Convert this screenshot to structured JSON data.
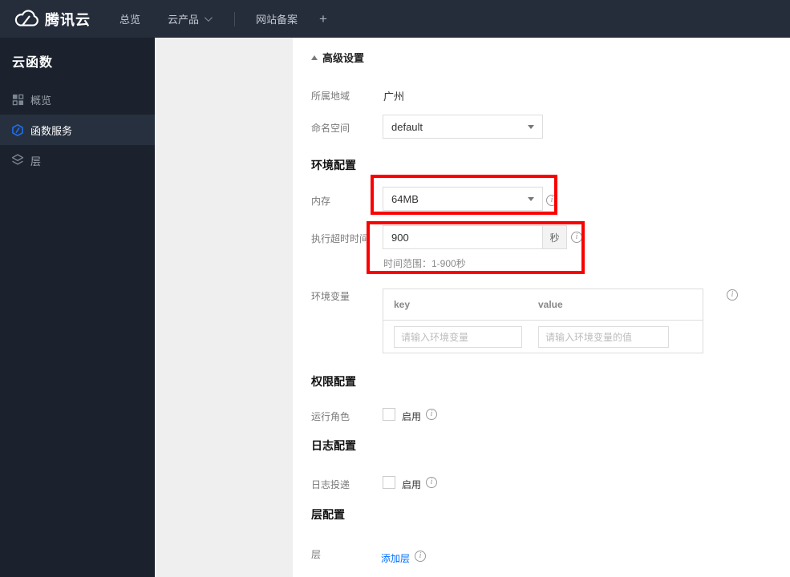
{
  "navbar": {
    "brand": "腾讯云",
    "overview": "总览",
    "products": "云产品",
    "icp": "网站备案",
    "add": "+"
  },
  "sidebar": {
    "title": "云函数",
    "items": [
      {
        "label": "概览",
        "icon": "grid-icon"
      },
      {
        "label": "函数服务",
        "icon": "scf-hexagon-icon"
      },
      {
        "label": "层",
        "icon": "layers-icon"
      }
    ]
  },
  "content": {
    "advanced_toggle": "高级设置",
    "region_label": "所属地域",
    "region_value": "广州",
    "namespace_label": "命名空间",
    "namespace_value": "default",
    "section_env": "环境配置",
    "memory_label": "内存",
    "memory_value": "64MB",
    "timeout_label": "执行超时时间",
    "timeout_value": "900",
    "timeout_unit": "秒",
    "timeout_hint": "时间范围：1-900秒",
    "envvar_label": "环境变量",
    "envvar_key_header": "key",
    "envvar_value_header": "value",
    "envvar_key_placeholder": "请输入环境变量",
    "envvar_value_placeholder": "请输入环境变量的值",
    "section_permission": "权限配置",
    "role_label": "运行角色",
    "role_enable": "启用",
    "section_log": "日志配置",
    "log_label": "日志投递",
    "log_enable": "启用",
    "section_layer": "层配置",
    "layer_label": "层",
    "layer_add_link": "添加层"
  },
  "colors": {
    "accent_blue": "#006eff",
    "annotation_red": "#fb0000",
    "navbar_bg": "#252d3b",
    "sidebar_bg": "#1b222d"
  }
}
